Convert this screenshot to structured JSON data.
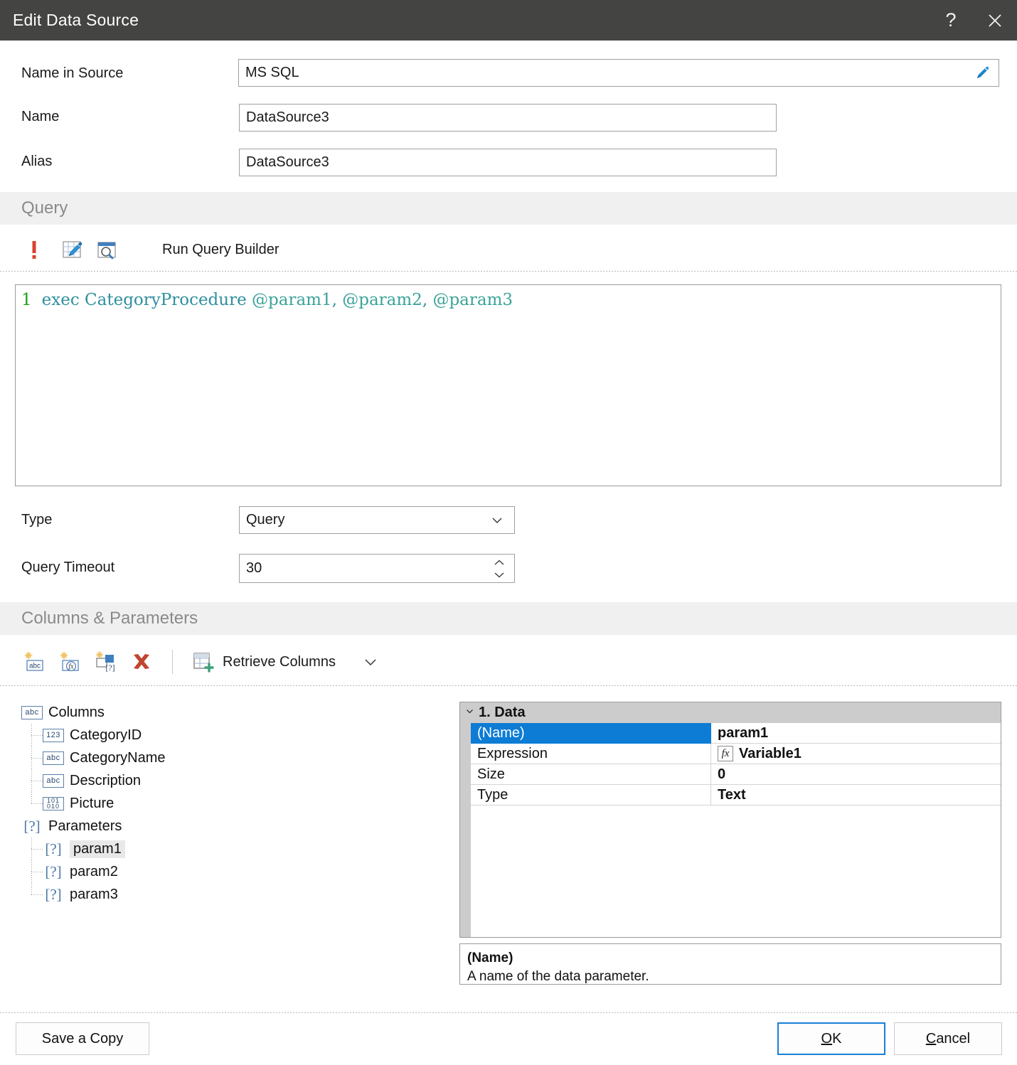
{
  "window": {
    "title": "Edit Data Source",
    "help_label": "?",
    "close_label": "×"
  },
  "form": {
    "name_in_source": {
      "label": "Name in Source",
      "value": "MS SQL",
      "edit_icon": "pencil-icon"
    },
    "name": {
      "label": "Name",
      "value": "DataSource3"
    },
    "alias": {
      "label": "Alias",
      "value": "DataSource3"
    }
  },
  "query_section": {
    "title": "Query",
    "toolbar": {
      "error_icon": "exclamation-icon",
      "edit_query_icon": "edit-query-icon",
      "preview_icon": "preview-query-icon",
      "run_query_builder_label": "Run Query Builder"
    },
    "editor": {
      "line_number": "1",
      "keyword_part": "exec CategoryProcedure ",
      "param1": "@param1",
      "sep1": ", ",
      "param2": "@param2",
      "sep2": ", ",
      "param3": "@param3"
    },
    "type": {
      "label": "Type",
      "value": "Query"
    },
    "query_timeout": {
      "label": "Query Timeout",
      "value": "30"
    }
  },
  "columns_section": {
    "title": "Columns & Parameters",
    "toolbar": {
      "new_column_icon": "new-column-icon",
      "new_calculated_column_icon": "new-calculated-column-icon",
      "new_parameter_icon": "new-parameter-icon",
      "delete_icon": "delete-icon",
      "retrieve_columns_label": "Retrieve Columns",
      "retrieve_columns_chevron": "chevron-down-icon"
    },
    "tree": {
      "columns_root": {
        "label": "Columns",
        "icon": "abc"
      },
      "columns": [
        {
          "label": "CategoryID",
          "icon": "123"
        },
        {
          "label": "CategoryName",
          "icon": "abc"
        },
        {
          "label": "Description",
          "icon": "abc"
        },
        {
          "label": "Picture",
          "icon": "binary"
        }
      ],
      "parameters_root": {
        "label": "Parameters",
        "icon": "[?]"
      },
      "parameters": [
        {
          "label": "param1",
          "icon": "[?]",
          "selected": true
        },
        {
          "label": "param2",
          "icon": "[?]",
          "selected": false
        },
        {
          "label": "param3",
          "icon": "[?]",
          "selected": false
        }
      ]
    },
    "property_grid": {
      "category": "1. Data",
      "rows": [
        {
          "name": "(Name)",
          "value": "param1",
          "selected": true,
          "has_fx": false
        },
        {
          "name": "Expression",
          "value": "Variable1",
          "selected": false,
          "has_fx": true,
          "fx_label": "fx"
        },
        {
          "name": "Size",
          "value": "0",
          "selected": false,
          "has_fx": false
        },
        {
          "name": "Type",
          "value": "Text",
          "selected": false,
          "has_fx": false
        }
      ]
    },
    "description": {
      "title": "(Name)",
      "text": "A name of the data parameter."
    }
  },
  "footer": {
    "save_a_copy": "Save a Copy",
    "ok_prefix": "O",
    "ok_suffix": "K",
    "cancel_prefix": "C",
    "cancel_suffix": "ancel"
  },
  "colors": {
    "titlebar": "#444442",
    "section_band": "#f0f0f0",
    "selection_blue": "#0c7cd5",
    "accent_blue": "#1a7fd4",
    "code_keyword": "#2f8f9d",
    "code_param": "#3aa39a",
    "code_linenumber": "#17a117",
    "error_red": "#d9432f"
  }
}
